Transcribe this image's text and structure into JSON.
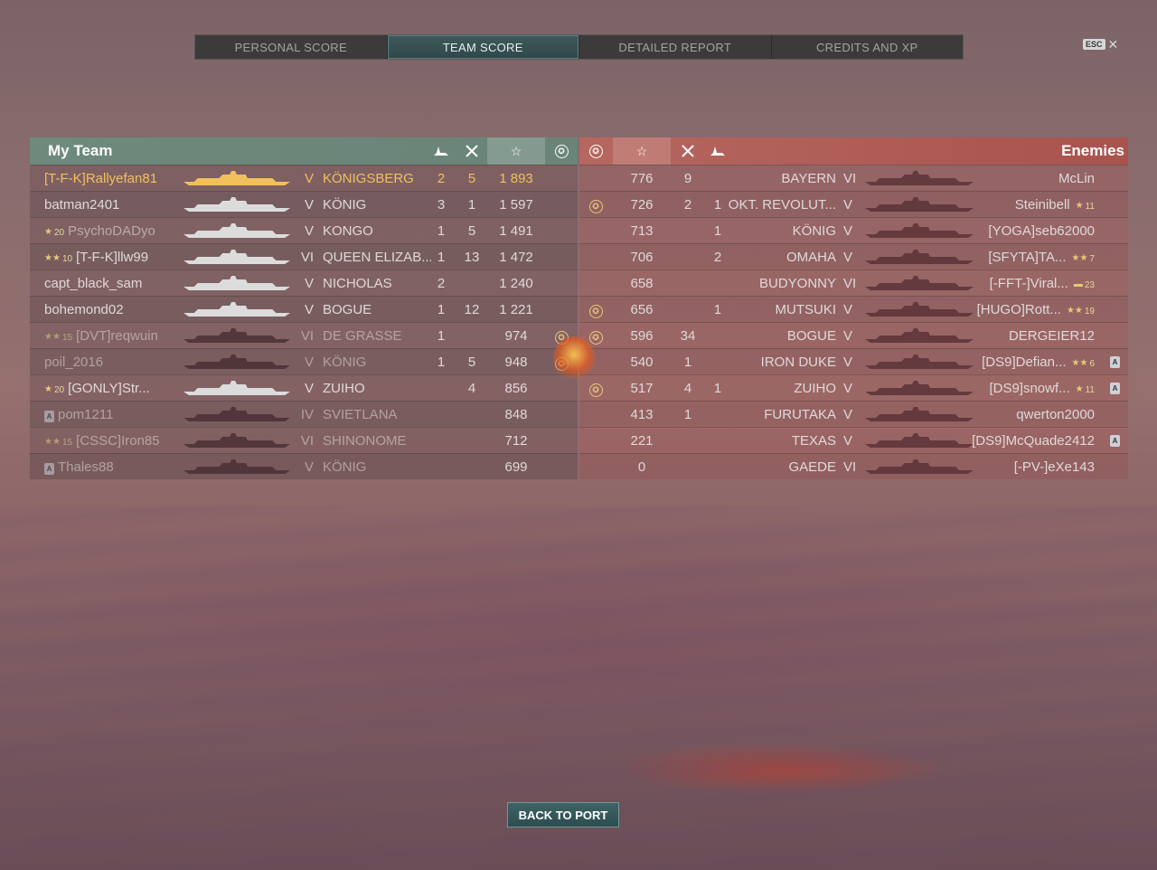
{
  "tabs": [
    "PERSONAL SCORE",
    "TEAM SCORE",
    "DETAILED REPORT",
    "CREDITS AND XP"
  ],
  "active_tab": 1,
  "esc_label": "ESC",
  "close_glyph": "✕",
  "my_team": {
    "title": "My Team",
    "header_icons": [
      "warship-icon",
      "crossed-swords-icon",
      "star-icon",
      "medal-icon"
    ],
    "rows": [
      {
        "name": "[T-F-K]Rallyefan81",
        "rank_icon": "",
        "rank": "",
        "badge": "",
        "tier": "V",
        "ship": "KÖNIGSBERG",
        "a": "2",
        "b": "5",
        "score": "1 893",
        "medal": false,
        "highlight": true
      },
      {
        "name": "batman2401",
        "rank_icon": "",
        "rank": "",
        "badge": "",
        "tier": "V",
        "ship": "KÖNIG",
        "a": "3",
        "b": "1",
        "score": "1 597",
        "medal": false,
        "highlight": false
      },
      {
        "name": "PsychoDADyo",
        "rank_icon": "★",
        "rank": "20",
        "badge": "",
        "tier": "V",
        "ship": "KONGO",
        "a": "1",
        "b": "5",
        "score": "1 491",
        "medal": false,
        "highlight": false,
        "dim_name": true
      },
      {
        "name": "[T-F-K]llw99",
        "rank_icon": "★★",
        "rank": "10",
        "badge": "",
        "tier": "VI",
        "ship": "QUEEN ELIZAB...",
        "a": "1",
        "b": "13",
        "score": "1 472",
        "medal": false,
        "highlight": false
      },
      {
        "name": "capt_black_sam",
        "rank_icon": "",
        "rank": "",
        "badge": "",
        "tier": "V",
        "ship": "NICHOLAS",
        "a": "2",
        "b": "",
        "score": "1 240",
        "medal": false,
        "highlight": false
      },
      {
        "name": "bohemond02",
        "rank_icon": "",
        "rank": "",
        "badge": "",
        "tier": "V",
        "ship": "BOGUE",
        "a": "1",
        "b": "12",
        "score": "1 221",
        "medal": false,
        "highlight": false
      },
      {
        "name": "[DVT]reqwuin",
        "rank_icon": "★★",
        "rank": "15",
        "badge": "",
        "tier": "VI",
        "ship": "DE GRASSE",
        "a": "1",
        "b": "",
        "score": "974",
        "medal": true,
        "highlight": false,
        "dead": true
      },
      {
        "name": "poil_2016",
        "rank_icon": "",
        "rank": "",
        "badge": "",
        "tier": "V",
        "ship": "KÖNIG",
        "a": "1",
        "b": "5",
        "score": "948",
        "medal": true,
        "highlight": false,
        "dead": true
      },
      {
        "name": "[GONLY]Str...",
        "rank_icon": "★",
        "rank": "20",
        "badge": "",
        "tier": "V",
        "ship": "ZUIHO",
        "a": "",
        "b": "4",
        "score": "856",
        "medal": false,
        "highlight": false
      },
      {
        "name": "pom1211",
        "rank_icon": "",
        "rank": "",
        "badge": "A",
        "tier": "IV",
        "ship": "SVIETLANA",
        "a": "",
        "b": "",
        "score": "848",
        "medal": false,
        "highlight": false,
        "dead": true
      },
      {
        "name": "[CSSC]Iron85",
        "rank_icon": "★★",
        "rank": "15",
        "badge": "",
        "tier": "VI",
        "ship": "SHINONOME",
        "a": "",
        "b": "",
        "score": "712",
        "medal": false,
        "highlight": false,
        "dead": true
      },
      {
        "name": "Thales88",
        "rank_icon": "",
        "rank": "",
        "badge": "A",
        "tier": "V",
        "ship": "KÖNIG",
        "a": "",
        "b": "",
        "score": "699",
        "medal": false,
        "highlight": false,
        "dead": true
      }
    ]
  },
  "enemies": {
    "title": "Enemies",
    "header_icons": [
      "medal-icon",
      "star-icon",
      "crossed-swords-icon",
      "warship-icon"
    ],
    "rows": [
      {
        "medal": false,
        "score": "776",
        "b": "9",
        "a": "",
        "ship": "BAYERN",
        "tier": "VI",
        "name": "McLin",
        "rank_icon": "",
        "rank": "",
        "badge": ""
      },
      {
        "medal": true,
        "score": "726",
        "b": "2",
        "a": "1",
        "ship": "OKT. REVOLUT...",
        "tier": "V",
        "name": "Steinibell",
        "rank_icon": "★",
        "rank": "11",
        "badge": ""
      },
      {
        "medal": false,
        "score": "713",
        "b": "",
        "a": "1",
        "ship": "KÖNIG",
        "tier": "V",
        "name": "[YOGA]seb62000",
        "rank_icon": "",
        "rank": "",
        "badge": ""
      },
      {
        "medal": false,
        "score": "706",
        "b": "",
        "a": "2",
        "ship": "OMAHA",
        "tier": "V",
        "name": "[SFYTA]TA...",
        "rank_icon": "★★",
        "rank": "7",
        "badge": ""
      },
      {
        "medal": false,
        "score": "658",
        "b": "",
        "a": "",
        "ship": "BUDYONNY",
        "tier": "VI",
        "name": "[-FFT-]Viral...",
        "rank_icon": "▬",
        "rank": "23",
        "badge": ""
      },
      {
        "medal": true,
        "score": "656",
        "b": "",
        "a": "1",
        "ship": "MUTSUKI",
        "tier": "V",
        "name": "[HUGO]Rott...",
        "rank_icon": "★★",
        "rank": "19",
        "badge": ""
      },
      {
        "medal": true,
        "score": "596",
        "b": "34",
        "a": "",
        "ship": "BOGUE",
        "tier": "V",
        "name": "DERGEIER12",
        "rank_icon": "",
        "rank": "",
        "badge": ""
      },
      {
        "medal": false,
        "score": "540",
        "b": "1",
        "a": "",
        "ship": "IRON DUKE",
        "tier": "V",
        "name": "[DS9]Defian...",
        "rank_icon": "★★",
        "rank": "6",
        "badge": "A"
      },
      {
        "medal": true,
        "score": "517",
        "b": "4",
        "a": "1",
        "ship": "ZUIHO",
        "tier": "V",
        "name": "[DS9]snowf...",
        "rank_icon": "★",
        "rank": "11",
        "badge": "A"
      },
      {
        "medal": false,
        "score": "413",
        "b": "1",
        "a": "",
        "ship": "FURUTAKA",
        "tier": "V",
        "name": "qwerton2000",
        "rank_icon": "",
        "rank": "",
        "badge": ""
      },
      {
        "medal": false,
        "score": "221",
        "b": "",
        "a": "",
        "ship": "TEXAS",
        "tier": "V",
        "name": "[DS9]McQuade2412",
        "rank_icon": "",
        "rank": "",
        "badge": "A"
      },
      {
        "medal": false,
        "score": "0",
        "b": "",
        "a": "",
        "ship": "GAEDE",
        "tier": "VI",
        "name": "[-PV-]eXe143",
        "rank_icon": "",
        "rank": "",
        "badge": ""
      }
    ]
  },
  "back_button": "BACK TO PORT"
}
